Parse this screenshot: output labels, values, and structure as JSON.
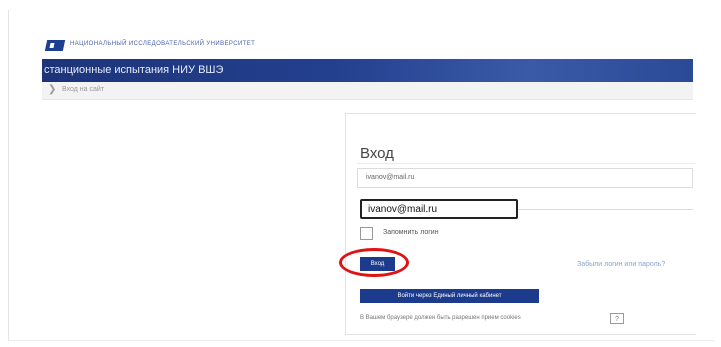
{
  "header": {
    "university_name": "НАЦИОНАЛЬНЫЙ ИССЛЕДОВАТЕЛЬСКИЙ УНИВЕРСИТЕТ",
    "banner_title": "станционные испытания НИУ ВШЭ"
  },
  "breadcrumb": {
    "label": "Вход на сайт"
  },
  "login": {
    "title": "Вход",
    "username_field_value": "ivanov@mail.ru",
    "zoomed_username_value": "ivanov@mail.ru",
    "remember_label": "Запомнить логин",
    "login_button": "Вход",
    "forgot_link": "Забыли логин или пароль?",
    "sso_button": "Войти через Единый личный кабинет",
    "cookie_note": "В Вашем браузере должен быть разрешен прием cookies",
    "help_icon": "?"
  },
  "colors": {
    "brand_blue": "#1d3b8c",
    "highlight_red": "#e01313"
  }
}
